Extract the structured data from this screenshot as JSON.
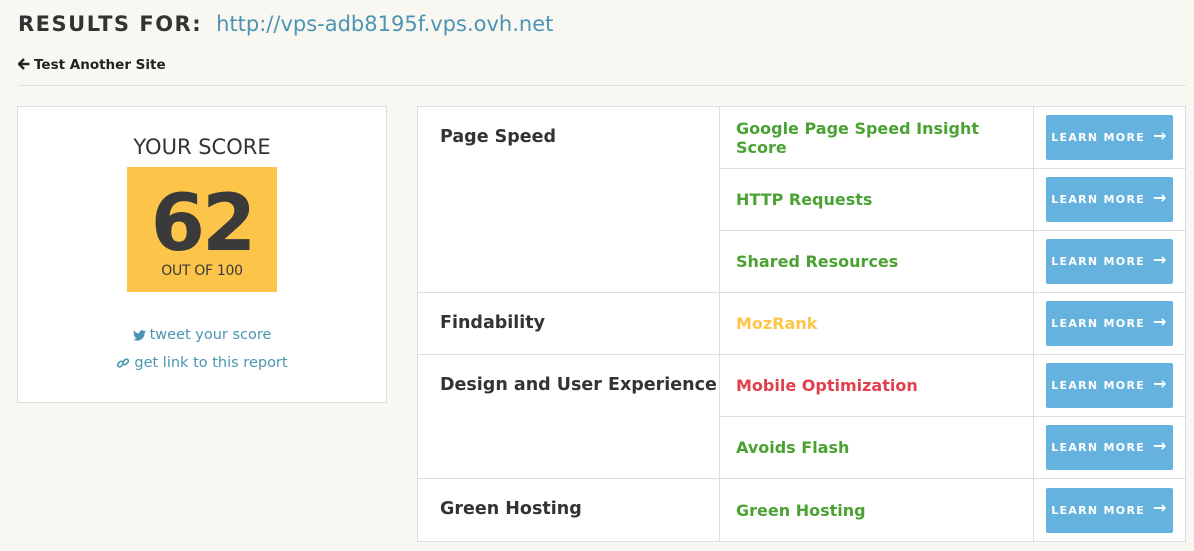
{
  "header": {
    "results_label": "RESULTS FOR:",
    "url": "http://vps-adb8195f.vps.ovh.net"
  },
  "back_link": {
    "label": "Test Another Site",
    "icon": "arrow-left-icon"
  },
  "score": {
    "title": "YOUR SCORE",
    "value": "62",
    "out_of": "OUT OF 100",
    "tile_color": "#fcc54a",
    "tweet_label": "tweet your score",
    "report_link_label": "get link to this report"
  },
  "colors": {
    "good": "#4aa233",
    "warning": "#fcc54a",
    "bad": "#e0404c",
    "button": "#66b2de",
    "link": "#4b95b2"
  },
  "groups": [
    {
      "category": "Page Speed",
      "metrics": [
        {
          "label": "Google Page Speed Insight Score",
          "status": "green",
          "button": "LEARN MORE"
        },
        {
          "label": "HTTP Requests",
          "status": "green",
          "button": "LEARN MORE"
        },
        {
          "label": "Shared Resources",
          "status": "green",
          "button": "LEARN MORE"
        }
      ]
    },
    {
      "category": "Findability",
      "metrics": [
        {
          "label": "MozRank",
          "status": "yellow",
          "button": "LEARN MORE"
        }
      ]
    },
    {
      "category": "Design and User Experience",
      "metrics": [
        {
          "label": "Mobile Optimization",
          "status": "red",
          "button": "LEARN MORE"
        },
        {
          "label": "Avoids Flash",
          "status": "green",
          "button": "LEARN MORE"
        }
      ]
    },
    {
      "category": "Green Hosting",
      "metrics": [
        {
          "label": "Green Hosting",
          "status": "green",
          "button": "LEARN MORE"
        }
      ]
    }
  ]
}
